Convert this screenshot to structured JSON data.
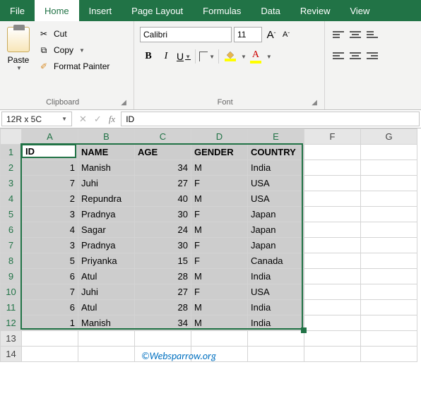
{
  "tabs": [
    "File",
    "Home",
    "Insert",
    "Page Layout",
    "Formulas",
    "Data",
    "Review",
    "View"
  ],
  "active_tab": "Home",
  "clipboard": {
    "paste": "Paste",
    "cut": "Cut",
    "copy": "Copy",
    "format_painter": "Format Painter",
    "label": "Clipboard"
  },
  "font": {
    "name": "Calibri",
    "size": "11",
    "bold": "B",
    "italic": "I",
    "underline": "U",
    "grow": "A",
    "shrink": "A",
    "font_color_letter": "A",
    "label": "Font"
  },
  "name_box": "12R x 5C",
  "formula_value": "ID",
  "columns": [
    "A",
    "B",
    "C",
    "D",
    "E",
    "F",
    "G"
  ],
  "headers": [
    "ID",
    "NAME",
    "AGE",
    "GENDER",
    "COUNTRY"
  ],
  "rows": [
    {
      "id": "1",
      "name": "Manish",
      "age": "34",
      "gender": "M",
      "country": "India"
    },
    {
      "id": "7",
      "name": "Juhi",
      "age": "27",
      "gender": "F",
      "country": "USA"
    },
    {
      "id": "2",
      "name": "Repundra",
      "age": "40",
      "gender": "M",
      "country": "USA"
    },
    {
      "id": "3",
      "name": "Pradnya",
      "age": "30",
      "gender": "F",
      "country": "Japan"
    },
    {
      "id": "4",
      "name": "Sagar",
      "age": "24",
      "gender": "M",
      "country": "Japan"
    },
    {
      "id": "3",
      "name": "Pradnya",
      "age": "30",
      "gender": "F",
      "country": "Japan"
    },
    {
      "id": "5",
      "name": "Priyanka",
      "age": "15",
      "gender": "F",
      "country": "Canada"
    },
    {
      "id": "6",
      "name": "Atul",
      "age": "28",
      "gender": "M",
      "country": "India"
    },
    {
      "id": "7",
      "name": "Juhi",
      "age": "27",
      "gender": "F",
      "country": "USA"
    },
    {
      "id": "6",
      "name": "Atul",
      "age": "28",
      "gender": "M",
      "country": "India"
    },
    {
      "id": "1",
      "name": "Manish",
      "age": "34",
      "gender": "M",
      "country": "India"
    }
  ],
  "watermark": "©Websparrow.org",
  "row_labels": [
    "1",
    "2",
    "3",
    "4",
    "5",
    "6",
    "7",
    "8",
    "9",
    "10",
    "11",
    "12",
    "13",
    "14"
  ]
}
